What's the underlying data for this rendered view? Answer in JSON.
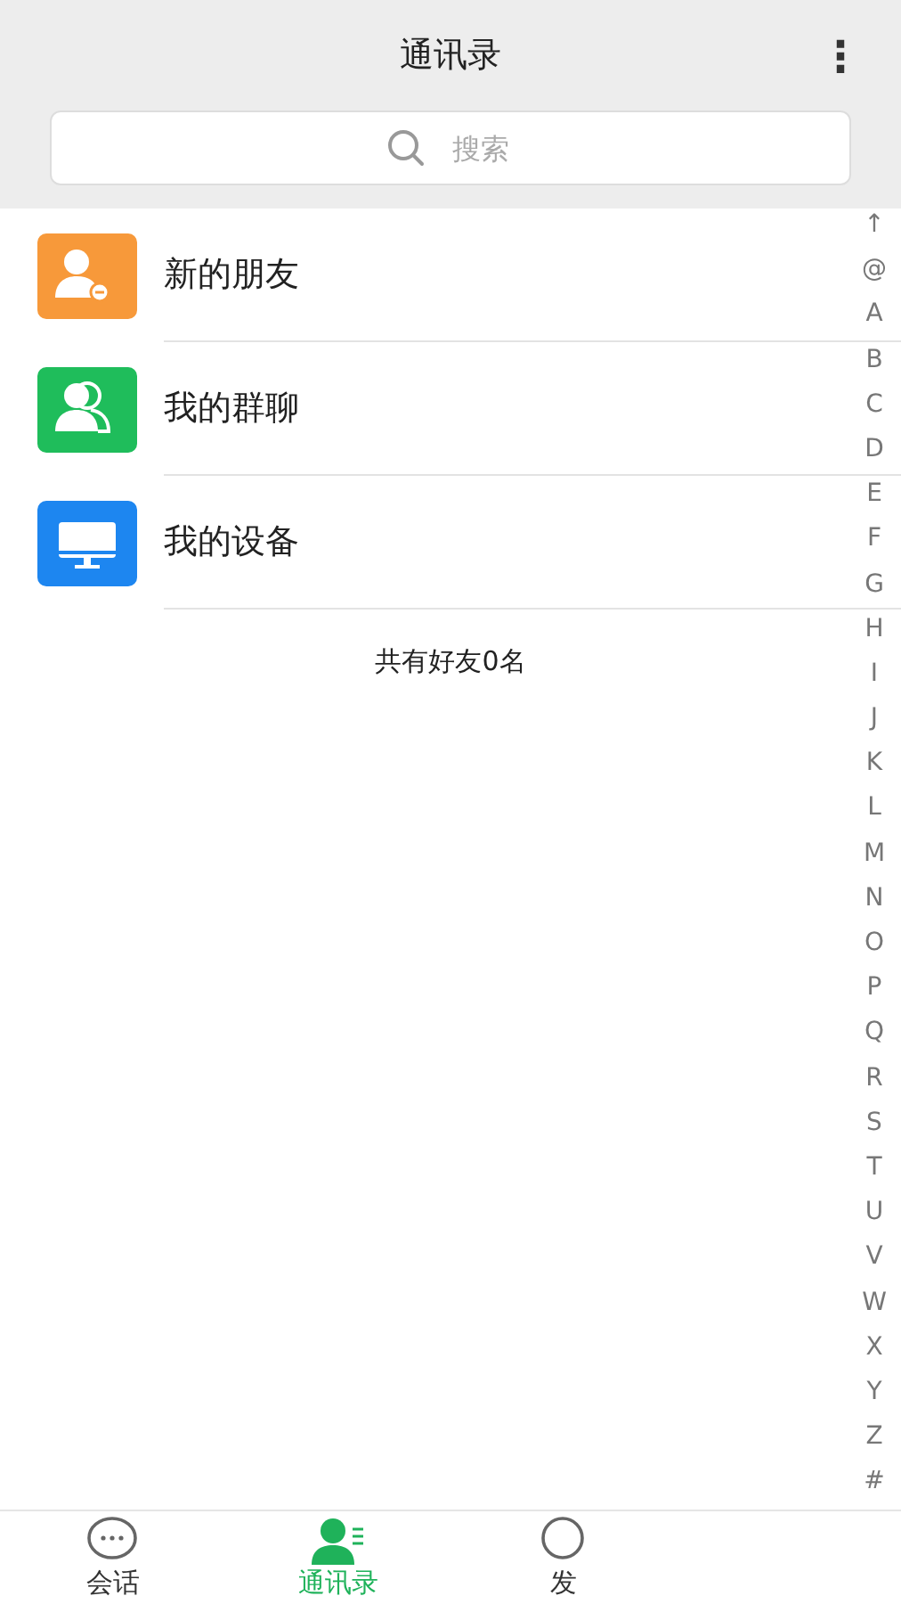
{
  "header": {
    "title": "通讯录",
    "menu": "⋮"
  },
  "search": {
    "placeholder": "搜索"
  },
  "entries": [
    {
      "kind": "new-friend",
      "label": "新的朋友",
      "color": "#f7993a"
    },
    {
      "kind": "group",
      "label": "我的群聊",
      "color": "#1fbd5b"
    },
    {
      "kind": "device",
      "label": "我的设备",
      "color": "#1d86f0"
    }
  ],
  "friend_count": "共有好友0名",
  "index": [
    "↑",
    "@",
    "A",
    "B",
    "C",
    "D",
    "E",
    "F",
    "G",
    "H",
    "I",
    "J",
    "K",
    "L",
    "M",
    "N",
    "O",
    "P",
    "Q",
    "R",
    "S",
    "T",
    "U",
    "V",
    "W",
    "X",
    "Y",
    "Z",
    "#"
  ],
  "tabs": [
    {
      "kind": "chat",
      "label": "会话",
      "selected": false
    },
    {
      "kind": "contacts",
      "label": "通讯录",
      "selected": true
    },
    {
      "kind": "discover",
      "label": "发",
      "selected": false
    }
  ]
}
